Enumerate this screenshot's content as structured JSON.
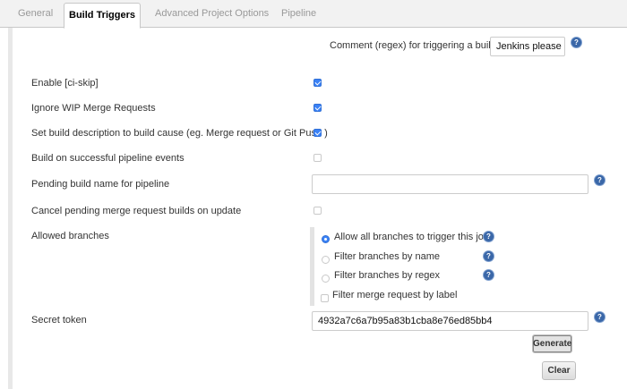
{
  "tabs": [
    {
      "label": "General"
    },
    {
      "label": "Build Triggers"
    },
    {
      "label": "Advanced Project Options"
    },
    {
      "label": "Pipeline"
    }
  ],
  "comment_regex": {
    "label": "Comment (regex) for triggering a build",
    "value": "Jenkins please retry a build"
  },
  "options": [
    {
      "label": "Enable [ci-skip]",
      "checked": true
    },
    {
      "label": "Ignore WIP Merge Requests",
      "checked": true
    },
    {
      "label": "Set build description to build cause (eg. Merge request or Git Push )",
      "checked": true
    },
    {
      "label": "Build on successful pipeline events",
      "checked": false
    }
  ],
  "pending_build_name": {
    "label": "Pending build name for pipeline",
    "value": ""
  },
  "cancel_pending": {
    "label": "Cancel pending merge request builds on update",
    "checked": false
  },
  "allowed_branches": {
    "label": "Allowed branches",
    "radios": [
      {
        "label": "Allow all branches to trigger this job",
        "selected": true
      },
      {
        "label": "Filter branches by name",
        "selected": false
      },
      {
        "label": "Filter branches by regex",
        "selected": false
      }
    ],
    "merge_label_filter": {
      "label": "Filter merge request by label",
      "checked": false
    }
  },
  "secret_token": {
    "label": "Secret token",
    "value": "4932a7c6a7b95a83b1cba8e76ed85bb4"
  },
  "buttons": {
    "generate": "Generate",
    "clear": "Clear"
  },
  "help_glyph": "?",
  "icons": {
    "help": "help-icon",
    "checkbox": "checkbox",
    "radio": "radio-button"
  },
  "colors": {
    "accent": "#3b82f6",
    "help": "#3a67a8"
  }
}
